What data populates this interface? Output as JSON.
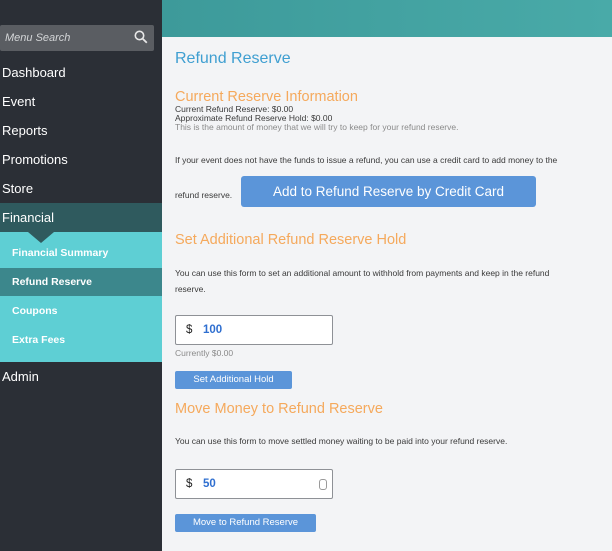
{
  "sidebar": {
    "search_placeholder": "Menu Search",
    "items": [
      {
        "label": "Dashboard"
      },
      {
        "label": "Event"
      },
      {
        "label": "Reports"
      },
      {
        "label": "Promotions"
      },
      {
        "label": "Store"
      },
      {
        "label": "Financial"
      },
      {
        "label": "Admin"
      }
    ],
    "subitems": [
      {
        "label": "Financial Summary"
      },
      {
        "label": "Refund Reserve"
      },
      {
        "label": "Coupons"
      },
      {
        "label": "Extra Fees"
      }
    ]
  },
  "main": {
    "title": "Refund Reserve",
    "current_info": {
      "heading": "Current Reserve Information",
      "line1": "Current Refund Reserve: $0.00",
      "line2": "Approximate Refund Reserve Hold: $0.00",
      "note": "This is the amount of money that we will try to keep for your refund reserve."
    },
    "funds_paragraph_a": "If your event does not have the funds to issue a refund, you can use a credit card to add money to the",
    "funds_paragraph_b": "refund reserve.",
    "credit_card_button": "Add to Refund Reserve by Credit Card",
    "additional_hold": {
      "heading": "Set Additional Refund Reserve Hold",
      "paragraph_a": "You can use this form to set an additional amount to withhold from payments and keep in the refund",
      "paragraph_b": "reserve.",
      "currency": "$",
      "value": "100",
      "currently": "Currently $0.00",
      "button": "Set Additional Hold"
    },
    "move_money": {
      "heading": "Move Money to Refund Reserve",
      "paragraph": "You can use this form to move settled money waiting to be paid into your refund reserve.",
      "currency": "$",
      "value": "50",
      "button": "Move to Refund Reserve"
    }
  },
  "colors": {
    "sidebar_bg": "#2b2f36",
    "subnav_bg": "#5ecfd4",
    "subnav_active": "#3c878c",
    "financial_active": "#2f5a5e",
    "accent_orange": "#f5a95c",
    "title_blue": "#3f9fd1",
    "button_blue": "#5b95d9"
  }
}
